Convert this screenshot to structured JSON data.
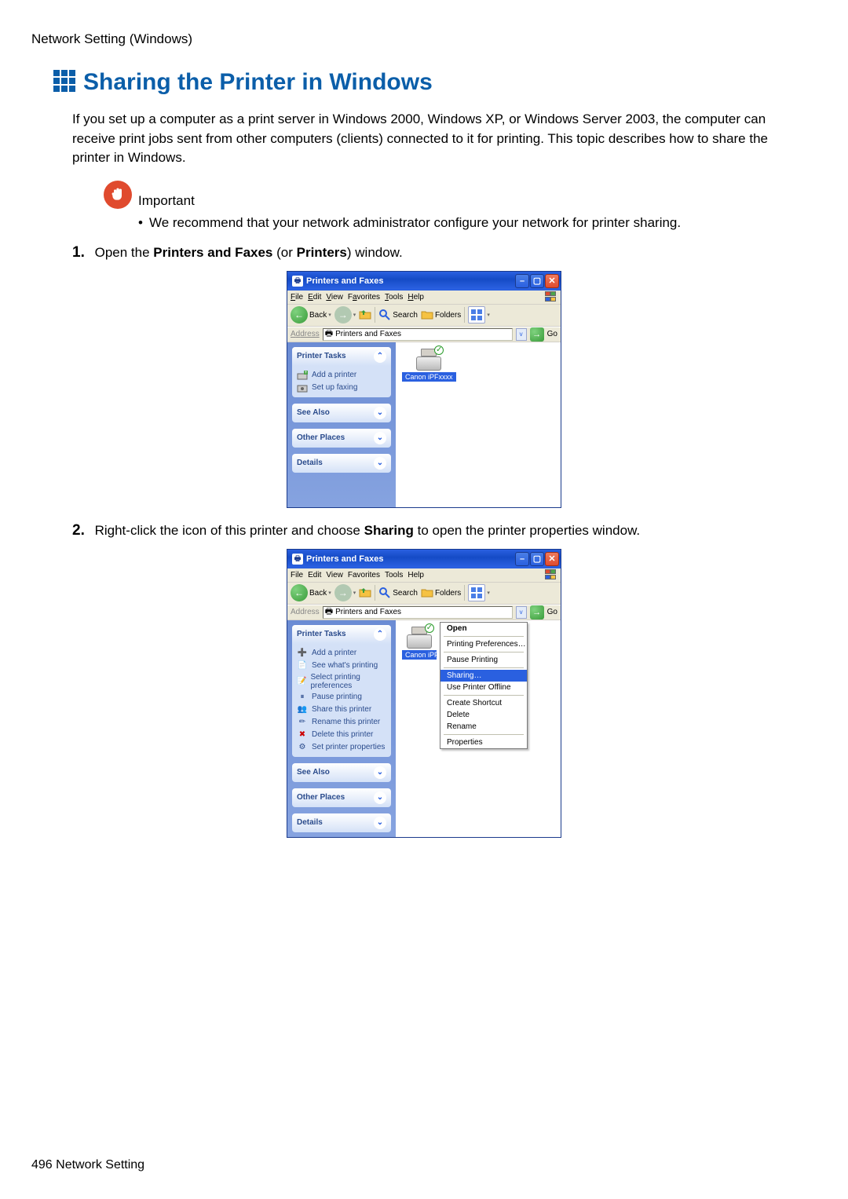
{
  "header_section": "Network Setting (Windows)",
  "heading": "Sharing the Printer in Windows",
  "intro": "If you set up a computer as a print server in Windows 2000, Windows XP, or Windows Server 2003, the computer can receive print jobs sent from other computers (clients) connected to it for printing. This topic describes how to share the printer in Windows.",
  "important_label": "Important",
  "important_bullet": "We recommend that your network administrator configure your network for printer sharing.",
  "step1_num": "1.",
  "step1_pre": "Open the ",
  "step1_bold1": "Printers and Faxes",
  "step1_mid": " (or ",
  "step1_bold2": "Printers",
  "step1_post": ") window.",
  "step2_num": "2.",
  "step2_pre": "Right-click the icon of this printer and choose ",
  "step2_bold": "Sharing",
  "step2_post": " to open the printer properties window.",
  "footer": "496  Network Setting",
  "win": {
    "title": "Printers and Faxes",
    "menu": {
      "file": "File",
      "file_u": "F",
      "edit": "Edit",
      "edit_u": "E",
      "view": "View",
      "view_u": "V",
      "fav": "Favorites",
      "fav_u": "a",
      "tools": "Tools",
      "tools_u": "T",
      "help": "Help",
      "help_u": "H"
    },
    "toolbar": {
      "back": "Back",
      "search": "Search",
      "folders": "Folders"
    },
    "addr_label": "Address",
    "addr_value": "Printers and Faxes",
    "go": "Go",
    "panels": {
      "printer_tasks": "Printer Tasks",
      "add_printer": "Add a printer",
      "setup_fax": "Set up faxing",
      "see_whats_printing": "See what's printing",
      "select_prefs": "Select printing preferences",
      "pause_printing": "Pause printing",
      "share_printer": "Share this printer",
      "rename_printer": "Rename this printer",
      "delete_printer": "Delete this printer",
      "set_props": "Set printer properties",
      "see_also": "See Also",
      "other_places": "Other Places",
      "details": "Details"
    },
    "printer_name_full": "Canon iPFxxxx",
    "printer_name_short": "Canon iPF",
    "ctx": {
      "open": "Open",
      "printing_prefs": "Printing Preferences…",
      "pause": "Pause Printing",
      "sharing": "Sharing…",
      "offline": "Use Printer Offline",
      "shortcut": "Create Shortcut",
      "delete": "Delete",
      "rename": "Rename",
      "properties": "Properties"
    }
  }
}
